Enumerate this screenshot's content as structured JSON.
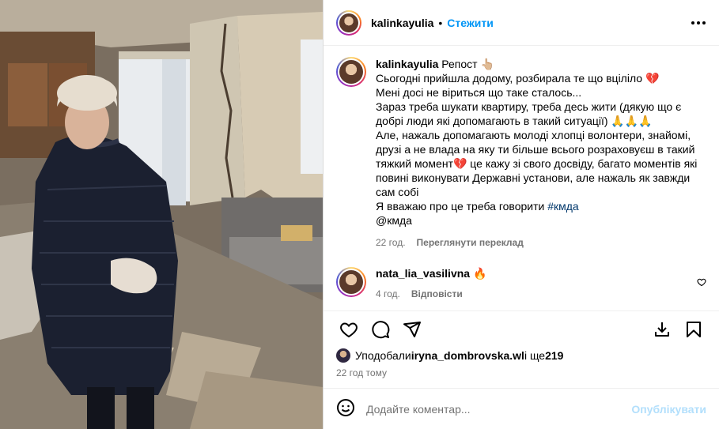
{
  "post": {
    "author": "kalinkayulia",
    "separator": "•",
    "follow_label": "Стежити"
  },
  "caption": {
    "author": "kalinkayulia",
    "repost_label": "Репост 👆🏼",
    "lines": [
      "Сьогодні прийшла додому, розбирала те що вціліло 💔",
      "Мені досі не віриться що таке сталось...",
      "Зараз треба шукати квартиру, треба десь жити (дякую що є",
      "добрі люди які допомагають в такий ситуації) 🙏🙏🙏",
      "Але, нажаль допомагають молоді хлопці волонтери, знайомі,",
      "друзі а не влада на яку ти більше всього розраховуєш в такий",
      "тяжкий момент💔 це кажу зі свого досвіду, багато моментів які",
      "повині виконувати Державні установи, але нажаль як завжди",
      "сам собі"
    ],
    "last_line_text": "Я вважаю про це треба говорити ",
    "hashtag": "#кмда",
    "mention": "@кмда",
    "time": "22 год.",
    "translate_label": "Переглянути переклад"
  },
  "comment": {
    "author": "nata_lia_vasilivna",
    "emoji": "🔥",
    "time": "4 год.",
    "reply_label": "Відповісти"
  },
  "likes": {
    "prefix": "Уподобали ",
    "user": "iryna_dombrovska.wl",
    "middle": " і ще ",
    "count": "219"
  },
  "timestamp": "22 год тому",
  "add_comment": {
    "placeholder": "Додайте коментар...",
    "publish_label": "Опублікувати"
  },
  "icons": {
    "more": "more-icon",
    "like": "heart-icon",
    "comment": "comment-icon",
    "share": "send-icon",
    "download": "download-icon",
    "save": "bookmark-icon",
    "emoji": "emoji-icon"
  },
  "colors": {
    "accent": "#0095f6",
    "muted": "#737373",
    "publish_disabled": "#b2dffc",
    "hashtag": "#00376b"
  }
}
